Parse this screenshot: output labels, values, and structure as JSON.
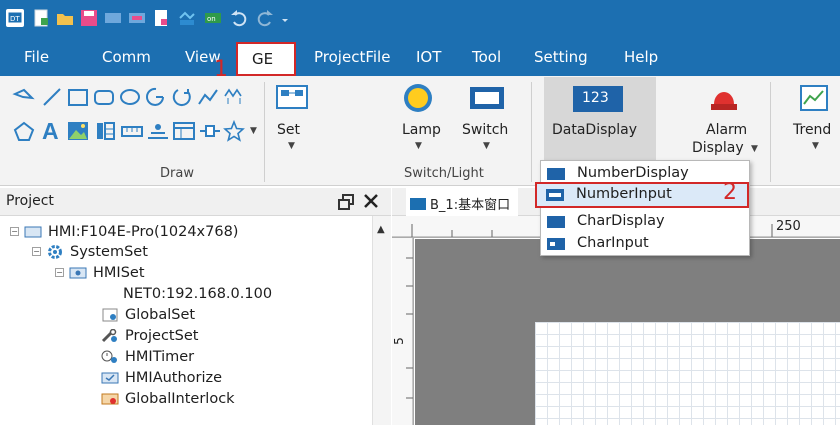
{
  "menu": {
    "items": [
      "File",
      "Comm",
      "View",
      "GE",
      "ProjectFile",
      "IOT",
      "Tool",
      "Setting",
      "Help"
    ],
    "active": "GE"
  },
  "annotations": {
    "step1": "1",
    "step2": "2"
  },
  "ribbon": {
    "draw_group_label": "Draw",
    "switch_group_label": "Switch/Light",
    "buttons": {
      "set": "Set",
      "lamp": "Lamp",
      "switch": "Switch",
      "data_display": "DataDisplay",
      "data_display_icon_text": "123",
      "alarm_line1": "Alarm",
      "alarm_line2": "Display",
      "trend": "Trend"
    }
  },
  "dropdown": {
    "items": [
      "NumberDisplay",
      "NumberInput",
      "CharDisplay",
      "CharInput"
    ],
    "highlighted": "NumberInput"
  },
  "project": {
    "title": "Project",
    "tree": {
      "root": "HMI:F104E-Pro(1024x768)",
      "system_set": "SystemSet",
      "hmi_set": "HMISet",
      "net0": "NET0:192.168.0.100",
      "global_set": "GlobalSet",
      "project_set": "ProjectSet",
      "hmi_timer": "HMITimer",
      "hmi_authorize": "HMIAuthorize",
      "global_interlock": "GlobalInterlock"
    }
  },
  "editor": {
    "tab_label": "B_1:基本窗口",
    "ruler_top_mark": "250",
    "ruler_left_mark": "5"
  },
  "colors": {
    "accent": "#1c6fb1",
    "highlight_box": "#d22828"
  }
}
